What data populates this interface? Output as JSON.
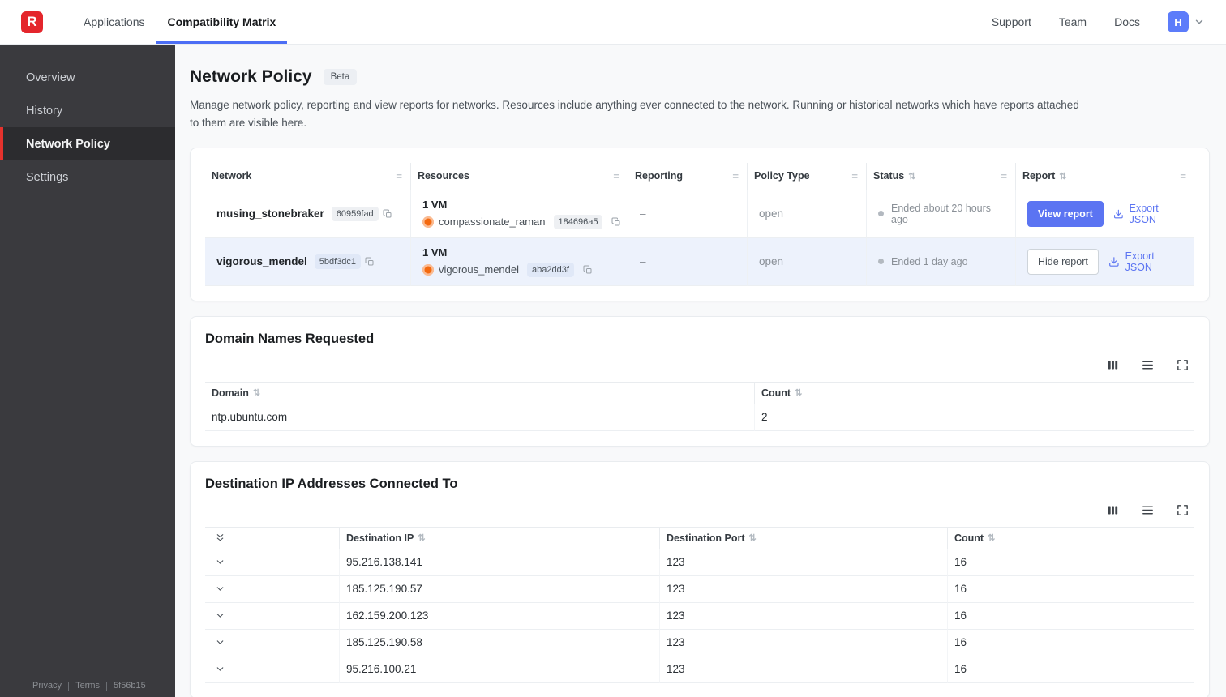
{
  "navbar": {
    "logo_letter": "R",
    "items": [
      {
        "label": "Applications",
        "active": false
      },
      {
        "label": "Compatibility Matrix",
        "active": true
      }
    ],
    "right_items": [
      {
        "label": "Support"
      },
      {
        "label": "Team"
      },
      {
        "label": "Docs"
      }
    ],
    "avatar_letter": "H"
  },
  "sidebar": {
    "items": [
      {
        "label": "Overview",
        "active": false
      },
      {
        "label": "History",
        "active": false
      },
      {
        "label": "Network Policy",
        "active": true
      },
      {
        "label": "Settings",
        "active": false
      }
    ],
    "footer": {
      "privacy": "Privacy",
      "terms": "Terms",
      "version": "5f56b15"
    }
  },
  "page": {
    "title": "Network Policy",
    "badge": "Beta",
    "description": "Manage network policy, reporting and view reports for networks. Resources include anything ever connected to the network. Running or historical networks which have reports attached to them are visible here."
  },
  "networks_table": {
    "columns": {
      "network": "Network",
      "resources": "Resources",
      "reporting": "Reporting",
      "policy_type": "Policy Type",
      "status": "Status",
      "report": "Report"
    },
    "rows": [
      {
        "name": "musing_stonebraker",
        "id": "60959fad",
        "vm_count": "1 VM",
        "resource_name": "compassionate_raman",
        "resource_id": "184696a5",
        "reporting": "–",
        "policy_type": "open",
        "status": "Ended about 20 hours ago",
        "report_button": "View report",
        "export_label": "Export JSON"
      },
      {
        "name": "vigorous_mendel",
        "id": "5bdf3dc1",
        "vm_count": "1 VM",
        "resource_name": "vigorous_mendel",
        "resource_id": "aba2dd3f",
        "reporting": "–",
        "policy_type": "open",
        "status": "Ended 1 day ago",
        "report_button": "Hide report",
        "export_label": "Export JSON"
      }
    ]
  },
  "domain_table": {
    "title": "Domain Names Requested",
    "columns": {
      "domain": "Domain",
      "count": "Count"
    },
    "rows": [
      {
        "domain": "ntp.ubuntu.com",
        "count": "2"
      }
    ]
  },
  "ip_table": {
    "title": "Destination IP Addresses Connected To",
    "columns": {
      "ip": "Destination IP",
      "port": "Destination Port",
      "count": "Count"
    },
    "rows": [
      {
        "ip": "95.216.138.141",
        "port": "123",
        "count": "16"
      },
      {
        "ip": "185.125.190.57",
        "port": "123",
        "count": "16"
      },
      {
        "ip": "162.159.200.123",
        "port": "123",
        "count": "16"
      },
      {
        "ip": "185.125.190.58",
        "port": "123",
        "count": "16"
      },
      {
        "ip": "95.216.100.21",
        "port": "123",
        "count": "16"
      }
    ]
  },
  "colors": {
    "accent_blue": "#5b74f2",
    "tab_underline": "#4c6ef5",
    "brand_red": "#e4262c",
    "sidebar_bg": "#3a3a3e",
    "highlight_row": "#edf2fc"
  }
}
